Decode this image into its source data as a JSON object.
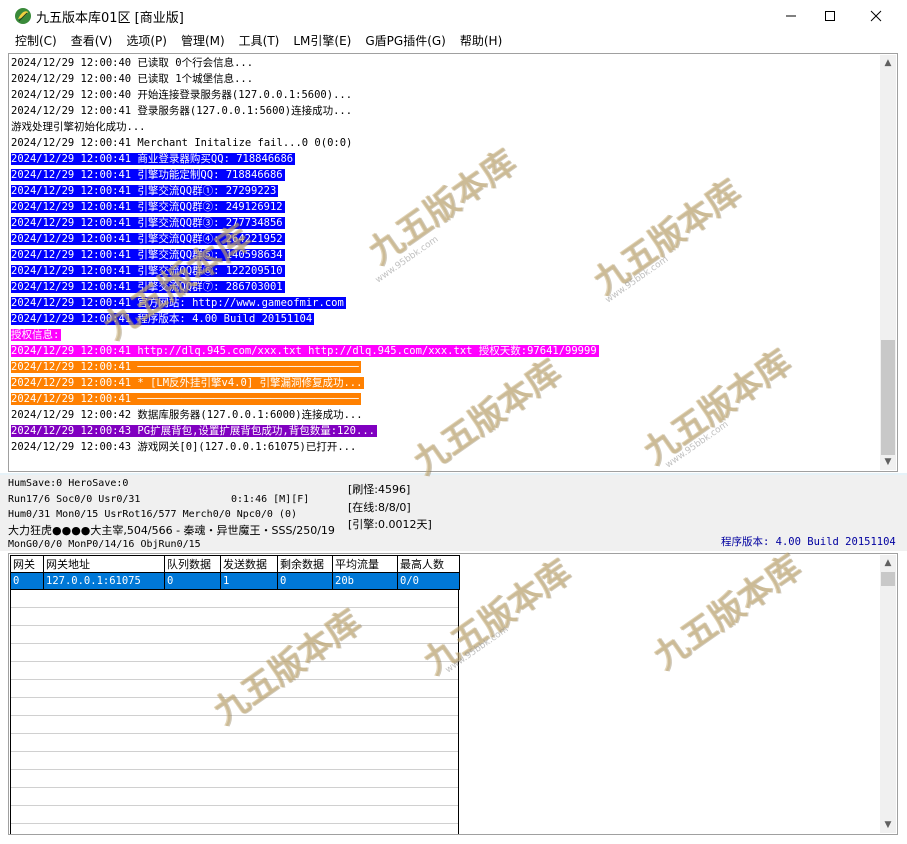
{
  "window": {
    "title": "九五版本库01区 [商业版]",
    "icon": "app-leaf-icon",
    "controls": {
      "minimize": "—",
      "maximize": "☐",
      "close": "✕"
    }
  },
  "menu": [
    "控制(C)",
    "查看(V)",
    "选项(P)",
    "管理(M)",
    "工具(T)",
    "LM引擎(E)",
    "G盾PG插件(G)",
    "帮助(H)"
  ],
  "log": [
    {
      "text": "2024/12/29 12:00:40 已读取 0个行会信息...",
      "style": "plain"
    },
    {
      "text": "2024/12/29 12:00:40 已读取 1个城堡信息...",
      "style": "plain"
    },
    {
      "text": "2024/12/29 12:00:40 开始连接登录服务器(127.0.0.1:5600)...",
      "style": "plain"
    },
    {
      "text": "2024/12/29 12:00:41 登录服务器(127.0.0.1:5600)连接成功...",
      "style": "plain"
    },
    {
      "text": "游戏处理引擎初始化成功...",
      "style": "plain"
    },
    {
      "text": "2024/12/29 12:00:41 Merchant Initalize fail...0 0(0:0)",
      "style": "plain"
    },
    {
      "text": "2024/12/29 12:00:41 商业登录器购买QQ: 718846686",
      "style": "blue"
    },
    {
      "text": "2024/12/29 12:00:41 引擎功能定制QQ: 718846686",
      "style": "blue"
    },
    {
      "text": "2024/12/29 12:00:41 引擎交流QQ群①: 27299223",
      "style": "blue"
    },
    {
      "text": "2024/12/29 12:00:41 引擎交流QQ群②: 249126912",
      "style": "blue"
    },
    {
      "text": "2024/12/29 12:00:41 引擎交流QQ群③: 277734856",
      "style": "blue"
    },
    {
      "text": "2024/12/29 12:00:41 引擎交流QQ群④: 264221952",
      "style": "blue"
    },
    {
      "text": "2024/12/29 12:00:41 引擎交流QQ群⑤: 140598634",
      "style": "blue"
    },
    {
      "text": "2024/12/29 12:00:41 引擎交流QQ群⑥: 122209510",
      "style": "blue"
    },
    {
      "text": "2024/12/29 12:00:41 引擎交流QQ群⑦: 286703001",
      "style": "blue"
    },
    {
      "text": "2024/12/29 12:00:41 官方网站: http://www.gameofmir.com",
      "style": "blue"
    },
    {
      "text": "2024/12/29 12:00:41 程序版本: 4.00 Build 20151104",
      "style": "blue"
    },
    {
      "text": "授权信息:",
      "style": "magenta"
    },
    {
      "text": "2024/12/29 12:00:41 http://dlq.945.com/xxx.txt http://dlq.945.com/xxx.txt 授权天数:97641/99999",
      "style": "magenta"
    },
    {
      "text": "2024/12/29 12:00:41 ───────────────────────────────────",
      "style": "orange"
    },
    {
      "text": "2024/12/29 12:00:41 * [LM反外挂引擎v4.0] 引擎漏洞修复成功...",
      "style": "orange"
    },
    {
      "text": "2024/12/29 12:00:41 ───────────────────────────────────",
      "style": "orange"
    },
    {
      "text": "2024/12/29 12:00:42 数据库服务器(127.0.0.1:6000)连接成功...",
      "style": "plain"
    },
    {
      "text": "2024/12/29 12:00:43 PG扩展背包,设置扩展背包成功,背包数量:120...",
      "style": "purple"
    },
    {
      "text": "2024/12/29 12:00:43 游戏网关[0](127.0.0.1:61075)已打开...",
      "style": "plain"
    }
  ],
  "status": {
    "save": "HumSave:0 HeroSave:0",
    "run": "Run17/6 Soc0/0 Usr0/31",
    "timer": "0:1:46 [M][F]",
    "hum": "Hum0/31 Mon0/15 UsrRot16/577 Merch0/0 Npc0/0 (0)",
    "player": "大力狂虎●●●●大主宰,504/566 - 秦魂・异世魔王・SSS/250/19",
    "mongo": "MonG0/0/0 MonP0/14/16 ObjRun0/15",
    "refresh": "[刷怪:4596]",
    "online": "[在线:8/8/0]",
    "engine": "[引擎:0.0012天]",
    "version": "程序版本: 4.00 Build 20151104"
  },
  "gateway_table": {
    "headers": [
      "网关",
      "网关地址",
      "队列数据",
      "发送数据",
      "剩余数据",
      "平均流量",
      "最高人数"
    ],
    "rows": [
      [
        "0",
        "127.0.0.1:61075",
        "0",
        "1",
        "0",
        "20b",
        "0/0"
      ]
    ]
  },
  "watermarks": {
    "brand": "九五版本库",
    "url": "www.95bbk.com"
  }
}
